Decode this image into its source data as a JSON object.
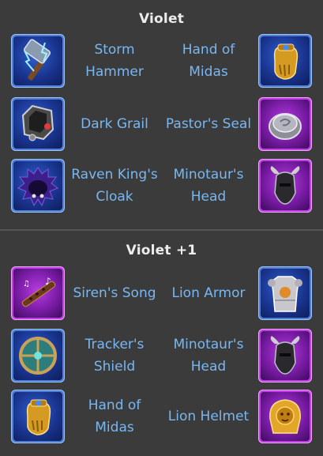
{
  "sections": [
    {
      "title": "Violet",
      "rows": [
        {
          "left": {
            "name": "Storm Hammer",
            "icon": "storm-hammer-icon",
            "rarity": "blue"
          },
          "right": {
            "name": "Hand of Midas",
            "icon": "hand-of-midas-icon",
            "rarity": "blue"
          }
        },
        {
          "left": {
            "name": "Dark Grail",
            "icon": "dark-grail-icon",
            "rarity": "blue"
          },
          "right": {
            "name": "Pastor's Seal",
            "icon": "pastors-seal-icon",
            "rarity": "purple"
          }
        },
        {
          "left": {
            "name": "Raven King's Cloak",
            "icon": "raven-kings-cloak-icon",
            "rarity": "blue"
          },
          "right": {
            "name": "Minotaur's Head",
            "icon": "minotaurs-head-icon",
            "rarity": "purple"
          }
        }
      ]
    },
    {
      "title": "Violet +1",
      "rows": [
        {
          "left": {
            "name": "Siren's Song",
            "icon": "sirens-song-icon",
            "rarity": "purple"
          },
          "right": {
            "name": "Lion Armor",
            "icon": "lion-armor-icon",
            "rarity": "blue"
          }
        },
        {
          "left": {
            "name": "Tracker's Shield",
            "icon": "trackers-shield-icon",
            "rarity": "blue"
          },
          "right": {
            "name": "Minotaur's Head",
            "icon": "minotaurs-head-icon",
            "rarity": "purple"
          }
        },
        {
          "left": {
            "name": "Hand of Midas",
            "icon": "hand-of-midas-icon",
            "rarity": "blue"
          },
          "right": {
            "name": "Lion Helmet",
            "icon": "lion-helmet-icon",
            "rarity": "purple"
          }
        }
      ]
    }
  ],
  "colors": {
    "background": "#3b3b3b",
    "title": "#ececec",
    "item_label": "#78b7f3",
    "rarity_blue": "#4e80d6",
    "rarity_purple": "#c23fe4"
  }
}
